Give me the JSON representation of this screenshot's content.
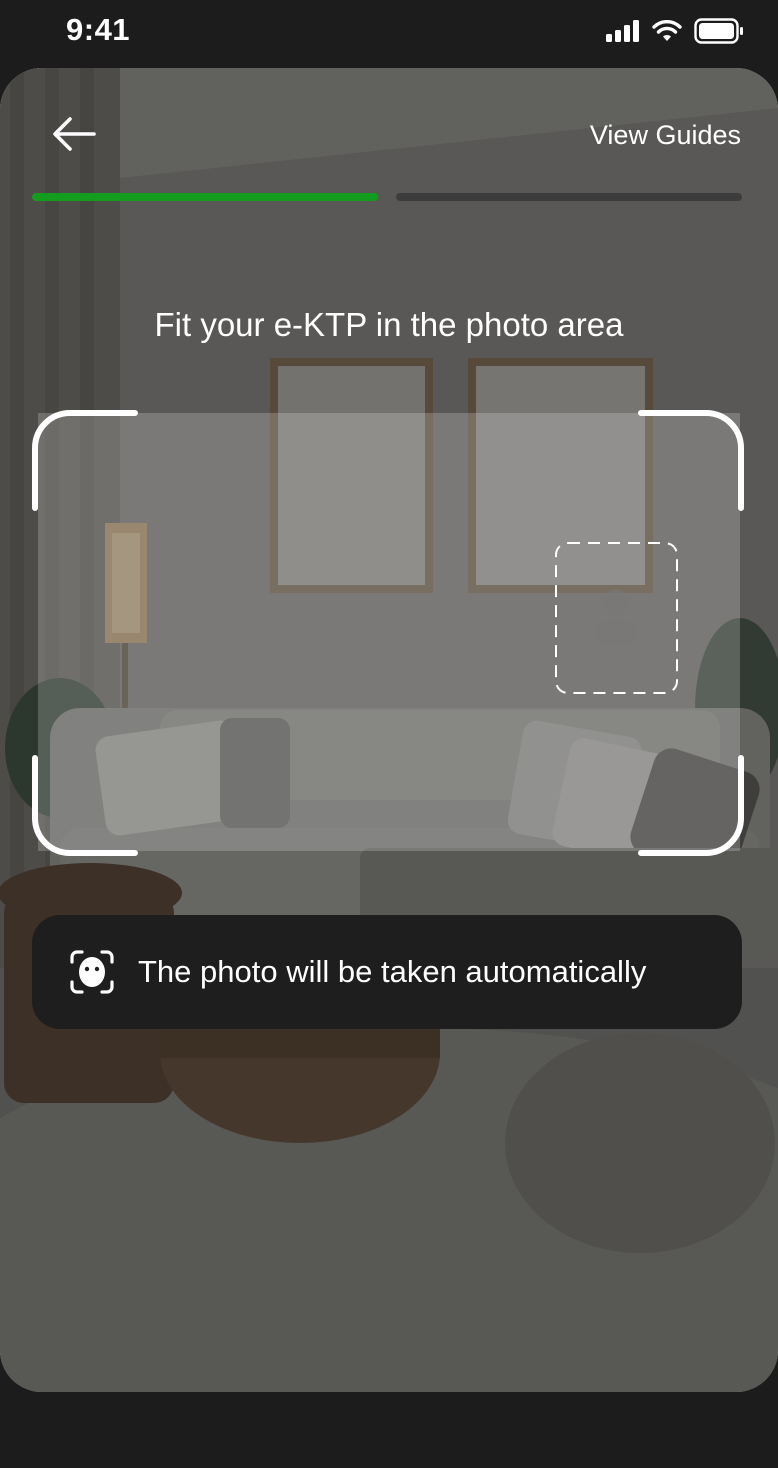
{
  "status_bar": {
    "time": "9:41",
    "icons": [
      "signal-icon",
      "wifi-icon",
      "battery-icon"
    ]
  },
  "header": {
    "back_icon": "arrow-left-icon",
    "view_guides_label": "View Guides"
  },
  "progress": {
    "total_steps": 2,
    "current_step": 1,
    "active_color": "#139c1e",
    "inactive_color": "#3c3c3c"
  },
  "instruction": "Fit your e-KTP in the photo area",
  "frame": {
    "photo_placeholder_icon": "person-photo-icon"
  },
  "banner": {
    "icon": "face-scan-icon",
    "text": "The photo will be taken automatically"
  }
}
